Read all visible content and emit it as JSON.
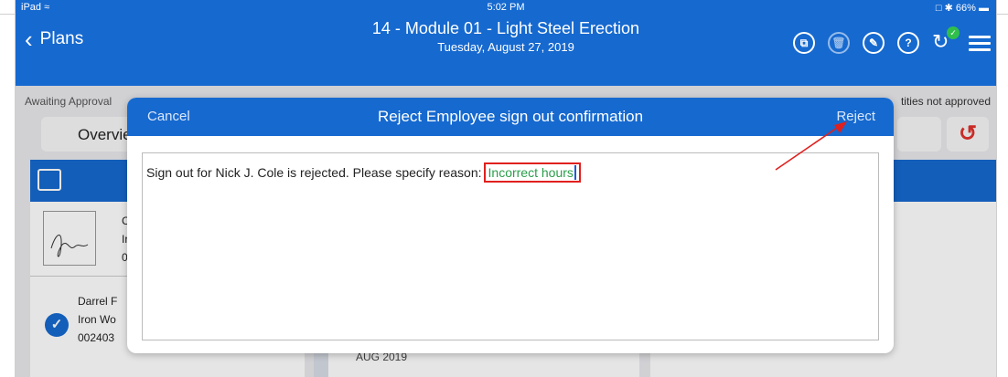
{
  "status_bar": {
    "device": "iPad",
    "wifi_icon": "wifi-icon",
    "time": "5:02 PM",
    "right": "66%"
  },
  "nav": {
    "back_label": "Plans",
    "title": "14 - Module 01 - Light Steel Erection",
    "subtitle": "Tuesday, August 27, 2019",
    "icons": [
      "copy-icon",
      "trash-icon",
      "edit-icon",
      "help-icon",
      "sync-icon",
      "menu-icon"
    ]
  },
  "background": {
    "awaiting_label": "Awaiting Approval",
    "quantities_label": "tities not approved",
    "tab_label": "Overvie",
    "row1_lines": [
      "C",
      "Ir",
      "0"
    ],
    "row2_lines": [
      "Darrel F",
      "Iron Wo",
      "002403"
    ],
    "aug_label": "AUG 2019",
    "right_gt": ">"
  },
  "modal": {
    "cancel_label": "Cancel",
    "title": "Reject Employee sign out confirmation",
    "reject_label": "Reject",
    "message": "Sign out for Nick J. Cole is rejected. Please specify reason:",
    "reason_value": "Incorrect hours"
  },
  "colors": {
    "primary": "#1669cf",
    "annotation_red": "#e0201e",
    "reason_green": "#2a9d4a"
  }
}
